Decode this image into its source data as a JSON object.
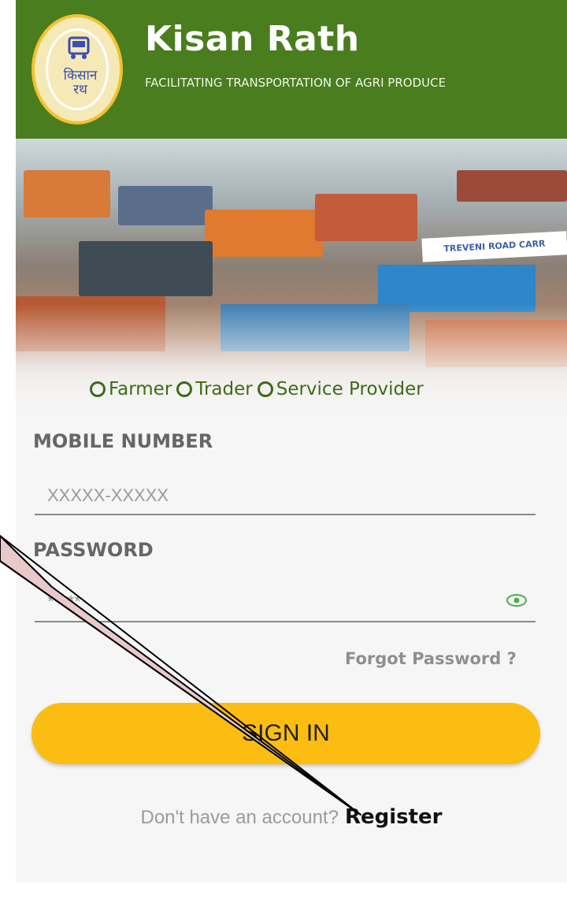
{
  "app": {
    "title": "Kisan Rath",
    "subtitle": "FACILITATING TRANSPORTATION OF AGRI PRODUCE",
    "logo_text_line1": "किसान",
    "logo_text_line2": "रथ"
  },
  "hero": {
    "sign_text": "TREVENI ROAD CARR"
  },
  "roles": [
    {
      "label": "Farmer"
    },
    {
      "label": "Trader"
    },
    {
      "label": "Service Provider"
    }
  ],
  "form": {
    "mobile_label": "MOBILE NUMBER",
    "mobile_placeholder": "XXXXX-XXXXX",
    "password_label": "PASSWORD",
    "password_placeholder": "*****",
    "forgot_label": "Forgot Password ?",
    "signin_label": "SIGN IN",
    "no_account_text": "Don't have an account?",
    "register_label": "Register"
  },
  "colors": {
    "header_green": "#4a7d1e",
    "accent_yellow": "#fbbd12",
    "radio_green": "#3d6b17"
  }
}
